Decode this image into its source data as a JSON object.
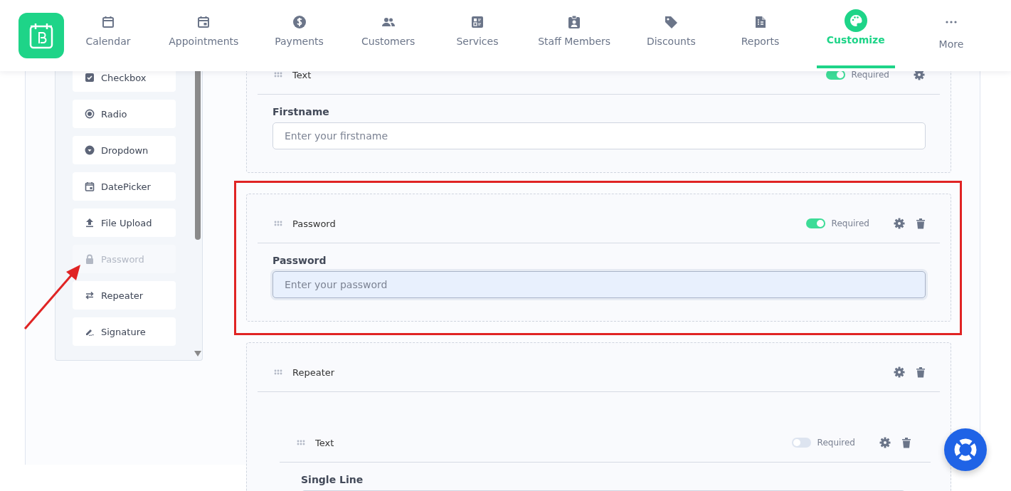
{
  "nav": {
    "items": [
      {
        "label": "Calendar",
        "kind": "calendar",
        "selected": false
      },
      {
        "label": "Appointments",
        "kind": "appointments",
        "selected": false
      },
      {
        "label": "Payments",
        "kind": "payments",
        "selected": false
      },
      {
        "label": "Customers",
        "kind": "customers",
        "selected": false
      },
      {
        "label": "Services",
        "kind": "services",
        "selected": false
      },
      {
        "label": "Staff Members",
        "kind": "staff",
        "selected": false
      },
      {
        "label": "Discounts",
        "kind": "discounts",
        "selected": false
      },
      {
        "label": "Reports",
        "kind": "reports",
        "selected": false
      },
      {
        "label": "Customize",
        "kind": "customize",
        "selected": true
      },
      {
        "label": "More",
        "kind": "more",
        "selected": false
      }
    ]
  },
  "sidebar": {
    "items": [
      {
        "label": "Checkbox",
        "kind": "checkbox",
        "disabled": false
      },
      {
        "label": "Radio",
        "kind": "radio",
        "disabled": false
      },
      {
        "label": "Dropdown",
        "kind": "dropdown",
        "disabled": false
      },
      {
        "label": "DatePicker",
        "kind": "datepicker",
        "disabled": false
      },
      {
        "label": "File Upload",
        "kind": "upload",
        "disabled": false
      },
      {
        "label": "Password",
        "kind": "password",
        "disabled": true
      },
      {
        "label": "Repeater",
        "kind": "repeater",
        "disabled": false
      },
      {
        "label": "Signature",
        "kind": "signature",
        "disabled": false
      }
    ]
  },
  "form": {
    "fields": [
      {
        "type": "Text",
        "kind": "input",
        "required": true,
        "required_label": "Required",
        "deletable": false,
        "label": "Firstname",
        "placeholder": "Enter your firstname",
        "focused": false,
        "highlighted": false
      },
      {
        "type": "Password",
        "kind": "input",
        "required": true,
        "required_label": "Required",
        "deletable": true,
        "label": "Password",
        "placeholder": "Enter your password",
        "focused": true,
        "highlighted": true
      },
      {
        "type": "Repeater",
        "kind": "repeater",
        "deletable": true,
        "highlighted": false,
        "children": [
          {
            "type": "Text",
            "kind": "input",
            "required": false,
            "required_label": "Required",
            "deletable": true,
            "label": "Single Line",
            "focused": false
          }
        ]
      }
    ]
  }
}
